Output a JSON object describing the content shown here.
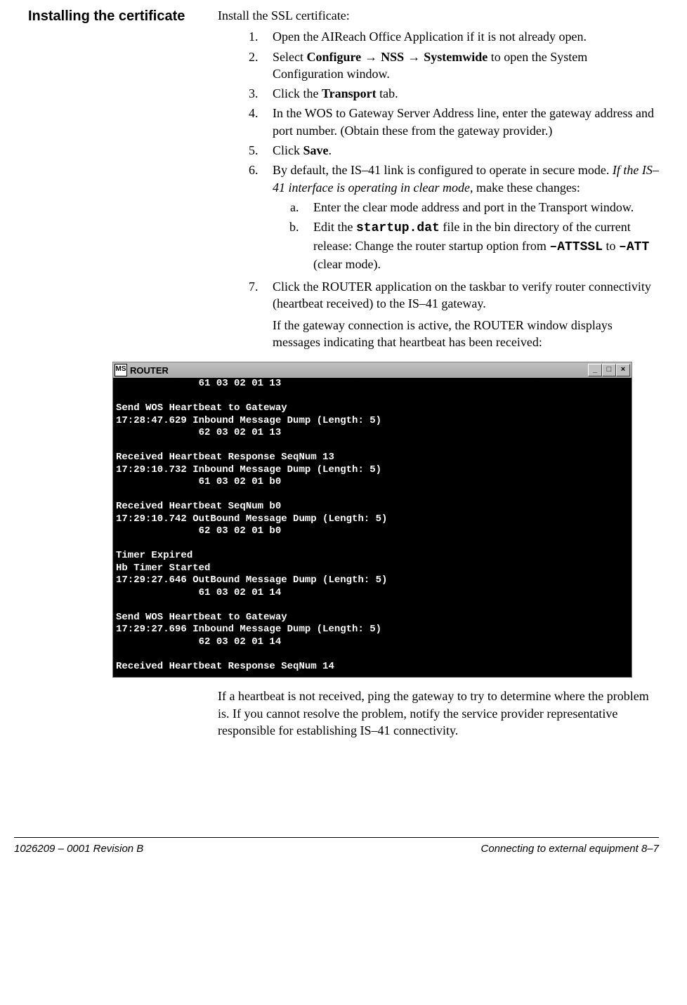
{
  "sideHeading": "Installing the certificate",
  "intro": "Install the SSL certificate:",
  "steps": {
    "s1": "Open the AIReach Office Application if it is not already open.",
    "s2_a": "Select ",
    "s2_b": "Configure",
    "s2_c": " →  ",
    "s2_d": "NSS",
    "s2_e": " →  ",
    "s2_f": "Systemwide",
    "s2_g": " to open the System Configuration window.",
    "s3_a": "Click the ",
    "s3_b": "Transport",
    "s3_c": " tab.",
    "s4": "In the WOS to Gateway Server Address line, enter the gateway address and port number. (Obtain these from the gateway provider.)",
    "s5_a": "Click ",
    "s5_b": "Save",
    "s5_c": ".",
    "s6_a": "By default, the IS–41 link is configured to operate in secure mode. ",
    "s6_b": "If the IS–41 interface is operating in clear mode,",
    "s6_c": " make these changes:",
    "s6_sub_a": "Enter the clear mode address and port in the Transport window.",
    "s6_sub_b_1": "Edit the ",
    "s6_sub_b_2": "startup.dat",
    "s6_sub_b_3": " file in the bin directory of the current release: Change the router startup option from ",
    "s6_sub_b_4": "–ATTSSL",
    "s6_sub_b_5": " to ",
    "s6_sub_b_6": "–ATT",
    "s6_sub_b_7": " (clear mode).",
    "s7_a": "Click the ROUTER application on the taskbar to verify router connectivity (heartbeat received) to the IS–41 gateway.",
    "s7_b": "If the gateway connection is active, the ROUTER window displays messages indicating that heartbeat has been received:"
  },
  "console": {
    "iconText": "MS",
    "title": "ROUTER",
    "minimize": "_",
    "maximize": "□",
    "close": "×",
    "body": "              61 03 02 01 13\n\nSend WOS Heartbeat to Gateway\n17:28:47.629 Inbound Message Dump (Length: 5)\n              62 03 02 01 13\n\nReceived Heartbeat Response SeqNum 13\n17:29:10.732 Inbound Message Dump (Length: 5)\n              61 03 02 01 b0\n\nReceived Heartbeat SeqNum b0\n17:29:10.742 OutBound Message Dump (Length: 5)\n              62 03 02 01 b0\n\nTimer Expired\nHb Timer Started\n17:29:27.646 OutBound Message Dump (Length: 5)\n              61 03 02 01 14\n\nSend WOS Heartbeat to Gateway\n17:29:27.696 Inbound Message Dump (Length: 5)\n              62 03 02 01 14\n\nReceived Heartbeat Response SeqNum 14\n"
  },
  "closing": "If a heartbeat is not received, ping the gateway to try to determine where the problem is. If you cannot resolve the problem, notify the service provider representative responsible for establishing IS–41 connectivity.",
  "footer": {
    "left": "1026209 – 0001  Revision B",
    "right": "Connecting to external equipment   8–7"
  }
}
